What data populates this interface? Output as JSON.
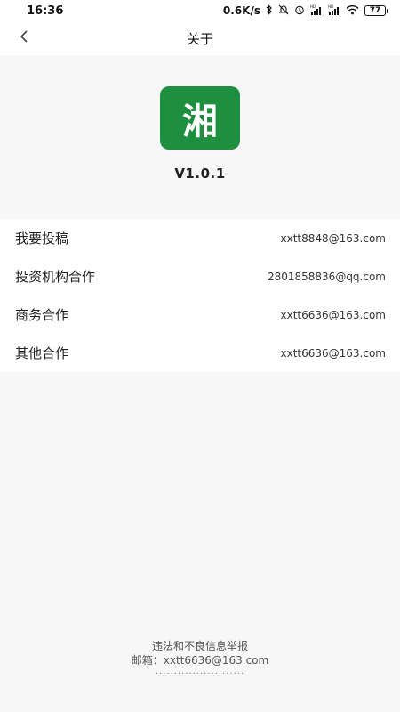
{
  "status_bar": {
    "time": "16:36",
    "net_speed": "0.6K/s",
    "battery": "77",
    "icons": [
      "bluetooth-icon",
      "mute-icon",
      "alarm-icon",
      "signal-hd-icon",
      "signal-hd-icon",
      "wifi-icon",
      "battery-icon"
    ]
  },
  "nav": {
    "title": "关于",
    "back_icon": "chevron-left-icon"
  },
  "app": {
    "logo_text": "湘",
    "logo_color": "#1e8f3e",
    "version": "V1.0.1"
  },
  "contacts": [
    {
      "label": "我要投稿",
      "value": "xxtt8848@163.com"
    },
    {
      "label": "投资机构合作",
      "value": "2801858836@qq.com"
    },
    {
      "label": "商务合作",
      "value": "xxtt6636@163.com"
    },
    {
      "label": "其他合作",
      "value": "xxtt6636@163.com"
    }
  ],
  "footer": {
    "report_text": "违法和不良信息举报",
    "email_line": "邮箱：xxtt6636@163.com",
    "dots": "........................"
  }
}
